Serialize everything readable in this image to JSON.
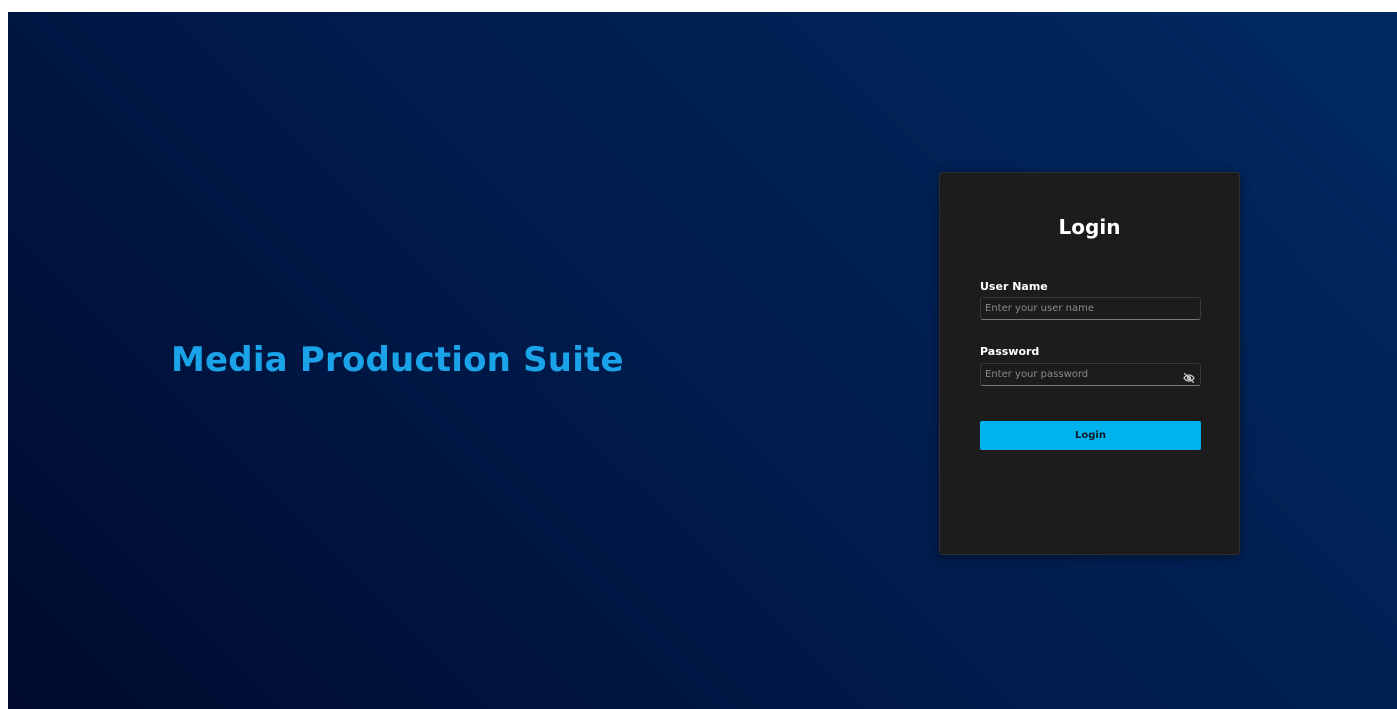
{
  "brand": {
    "title": "Media Production Suite",
    "color": "#1aa3e8"
  },
  "login_card": {
    "title": "Login",
    "username": {
      "label": "User Name",
      "placeholder": "Enter your user name",
      "value": ""
    },
    "password": {
      "label": "Password",
      "placeholder": "Enter your password",
      "value": "",
      "toggle_icon": "eye-off-icon"
    },
    "submit_label": "Login",
    "accent_color": "#00b2ee"
  }
}
